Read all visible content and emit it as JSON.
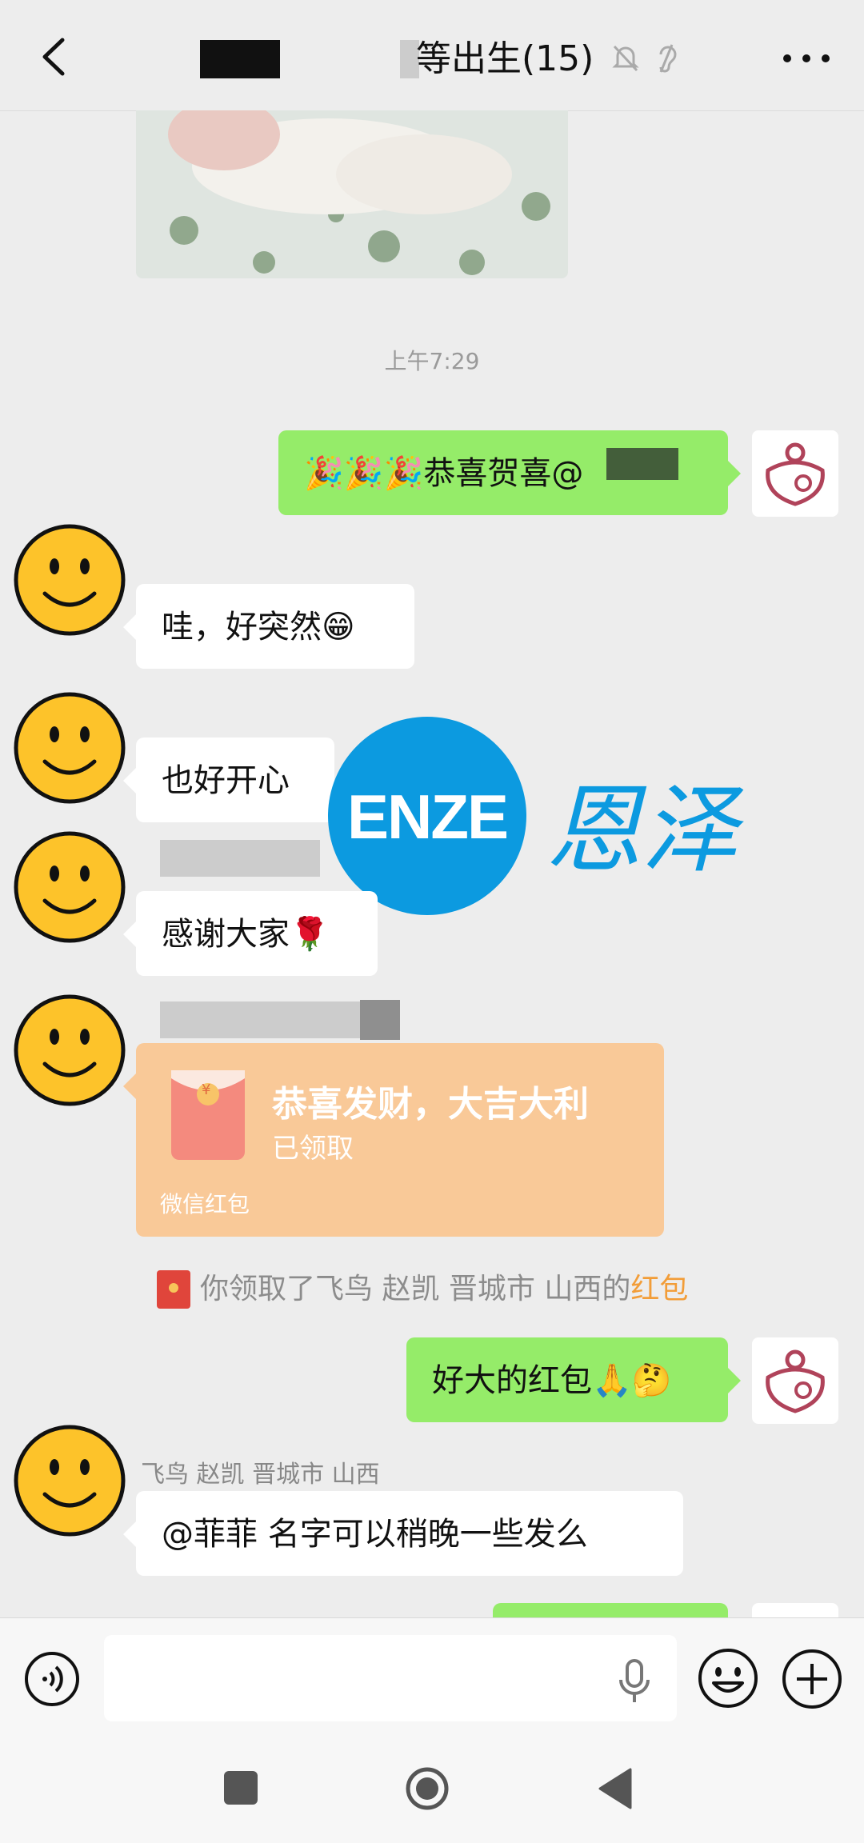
{
  "header": {
    "title": "等出生(15)",
    "icons": [
      "back-icon",
      "mute-bell-icon",
      "ear-icon",
      "more-icon"
    ]
  },
  "messages": {
    "time": "上午7:29",
    "m1": "🎉🎉🎉恭喜贺喜@",
    "m2": "哇，好突然😁",
    "m3": "也好开心",
    "m4": "感谢大家🌹",
    "packet": {
      "title": "恭喜发财，大吉大利",
      "status": "已领取",
      "footer": "微信红包",
      "symbol": "¥"
    },
    "system": {
      "prefix": "你领取了飞鸟 赵凯 晋城市 山西的",
      "highlight": "红包"
    },
    "m5": "好大的红包🙏🤔",
    "sender": "飞鸟 赵凯 晋城市 山西",
    "m6": "@菲菲  名字可以稍晚一些发么"
  },
  "watermark": {
    "latin": "ENZE",
    "cn": "恩泽"
  },
  "input": {
    "placeholder": ""
  },
  "colors": {
    "bubble_self": "#95ec69",
    "red_packet": "#f9c998",
    "watermark_blue": "#0c9ae0",
    "highlight": "#f29d38"
  }
}
